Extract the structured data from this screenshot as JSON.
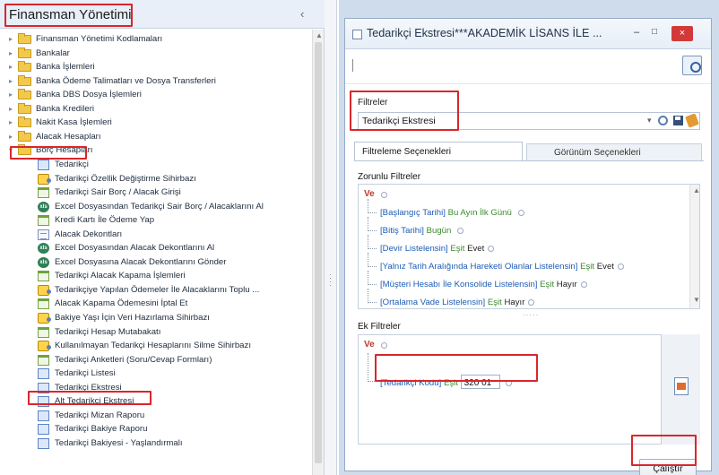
{
  "left_panel": {
    "title": "Finansman Yönetimi",
    "collapse_glyph": "‹",
    "top_items": [
      "Finansman Yönetimi Kodlamaları",
      "Bankalar",
      "Banka İşlemleri",
      "Banka Ödeme Talimatları ve Dosya Transferleri",
      "Banka DBS Dosya İşlemleri",
      "Banka Kredileri",
      "Nakit Kasa İşlemleri",
      "Alacak Hesapları"
    ],
    "expanded_item": "Borç Hesapları",
    "children": [
      {
        "label": "Tedarikçi",
        "icon": "supplier-icon"
      },
      {
        "label": "Tedarikçi Özellik Değiştirme Sihirbazı",
        "icon": "wizard-icon"
      },
      {
        "label": "Tedarikçi Sair Borç / Alacak Girişi",
        "icon": "form-icon"
      },
      {
        "label": "Excel Dosyasından Tedarikçi Sair Borç / Alacaklarını Al",
        "icon": "excel-icon"
      },
      {
        "label": "Kredi Kartı İle Ödeme Yap",
        "icon": "form-icon"
      },
      {
        "label": "Alacak Dekontları",
        "icon": "document-icon"
      },
      {
        "label": "Excel Dosyasından Alacak Dekontlarını Al",
        "icon": "excel-icon"
      },
      {
        "label": "Excel Dosyasına Alacak Dekontlarını Gönder",
        "icon": "excel-icon"
      },
      {
        "label": "Tedarikçi Alacak Kapama İşlemleri",
        "icon": "form-icon"
      },
      {
        "label": "Tedarikçiye Yapılan Ödemeler İle Alacaklarını Toplu ...",
        "icon": "wizard-icon"
      },
      {
        "label": "Alacak Kapama Ödemesini İptal Et",
        "icon": "form-icon"
      },
      {
        "label": "Bakiye Yaşı İçin Veri Hazırlama Sihirbazı",
        "icon": "wizard-icon"
      },
      {
        "label": "Tedarikçi Hesap Mutabakatı",
        "icon": "form-icon"
      },
      {
        "label": "Kullanılmayan Tedarikçi Hesaplarını Silme Sihirbazı",
        "icon": "wizard-icon"
      },
      {
        "label": "Tedarikçi Anketleri (Soru/Cevap Formları)",
        "icon": "form-icon"
      },
      {
        "label": "Tedarikçi Listesi",
        "icon": "report-icon"
      },
      {
        "label": "Tedarikçi Ekstresi",
        "icon": "report-icon"
      },
      {
        "label": "Alt Tedarikçi Ekstresi",
        "icon": "report-icon"
      },
      {
        "label": "Tedarikçi Mizan Raporu",
        "icon": "report-icon"
      },
      {
        "label": "Tedarikçi Bakiye Raporu",
        "icon": "report-icon"
      },
      {
        "label": "Tedarikçi Bakiyesi - Yaşlandırmalı",
        "icon": "report-icon"
      }
    ]
  },
  "dialog": {
    "title": "Tedarikçi Ekstresi***AKADEMİK LİSANS İLE ...",
    "min_glyph": "–",
    "max_glyph": "□",
    "close_glyph": "×",
    "filters_label": "Filtreler",
    "filter_selected": "Tedarikçi Ekstresi",
    "tabs": [
      "Filtreleme Seçenekleri",
      "Görünüm Seçenekleri"
    ],
    "required_label": "Zorunlu Filtreler",
    "ve": "Ve",
    "required_filters": [
      {
        "field": "[Başlangıç Tarihi]",
        "op": "Bu Ayın İlk Günü",
        "value": ""
      },
      {
        "field": "[Bitiş Tarihi]",
        "op": "Bugün",
        "value": ""
      },
      {
        "field": "[Devir Listelensin]",
        "op": "Eşit",
        "value": "Evet"
      },
      {
        "field": "[Yalnız Tarih Aralığında Hareketi Olanlar Listelensin]",
        "op": "Eşit",
        "value": "Evet"
      },
      {
        "field": "[Müşteri Hesabı İle Konsolide Listelensin]",
        "op": "Eşit",
        "value": "Hayır"
      },
      {
        "field": "[Ortalama Vade Listelensin]",
        "op": "Eşit",
        "value": "Hayır"
      }
    ],
    "grip": "·····",
    "extra_label": "Ek Filtreler",
    "extra_filter": {
      "field": "[Tedarikçi Kodu]",
      "op": "Eşit",
      "value": "320 01"
    },
    "run_label": "Çalıştır"
  },
  "colors": {
    "highlight": "#d9262c",
    "field": "#1c5cb5",
    "operator": "#3c8a2e"
  }
}
